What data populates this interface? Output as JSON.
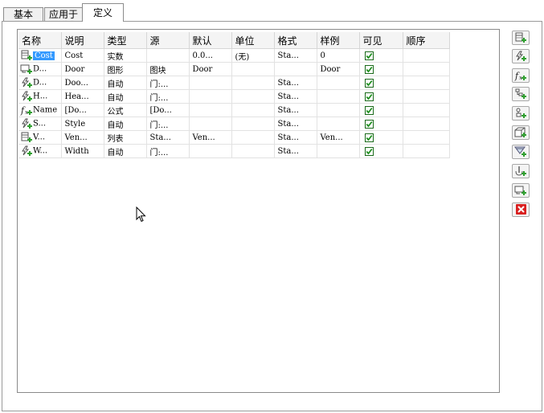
{
  "tabs": [
    {
      "label": "基本",
      "active": false
    },
    {
      "label": "应用于",
      "active": false
    },
    {
      "label": "定义",
      "active": true
    }
  ],
  "columns": [
    "名称",
    "说明",
    "类型",
    "源",
    "默认",
    "单位",
    "格式",
    "样例",
    "可见",
    "顺序"
  ],
  "rows": [
    {
      "icon": "table-plus-icon",
      "name": "Cost",
      "selected": true,
      "description": "Cost",
      "type": "实数",
      "source": "",
      "default": "0.0...",
      "unit": "(无)",
      "format": "Sta...",
      "example": "0",
      "visible": true,
      "order": ""
    },
    {
      "icon": "block-plus-icon",
      "name": "D...",
      "selected": false,
      "description": "Door",
      "type": "图形",
      "source": "图块",
      "default": "Door",
      "unit": "",
      "format": "",
      "example": "Door",
      "visible": true,
      "order": ""
    },
    {
      "icon": "auto-plus-icon",
      "name": "D...",
      "selected": false,
      "description": "Doo...",
      "type": "自动",
      "source": "门:...",
      "default": "",
      "unit": "",
      "format": "Sta...",
      "example": "",
      "visible": true,
      "order": ""
    },
    {
      "icon": "auto-plus-icon",
      "name": "H...",
      "selected": false,
      "description": "Hea...",
      "type": "自动",
      "source": "门:...",
      "default": "",
      "unit": "",
      "format": "Sta...",
      "example": "",
      "visible": true,
      "order": ""
    },
    {
      "icon": "formula-icon",
      "name": "Name",
      "selected": false,
      "description": "[Do...",
      "type": "公式",
      "source": "[Do...",
      "default": "",
      "unit": "",
      "format": "Sta...",
      "example": "",
      "visible": true,
      "order": ""
    },
    {
      "icon": "auto-plus-icon",
      "name": "S...",
      "selected": false,
      "description": "Style",
      "type": "自动",
      "source": "门:...",
      "default": "",
      "unit": "",
      "format": "Sta...",
      "example": "",
      "visible": true,
      "order": ""
    },
    {
      "icon": "table-plus-icon",
      "name": "V...",
      "selected": false,
      "description": "Ven...",
      "type": "列表",
      "source": "Sta...",
      "default": "Ven...",
      "unit": "",
      "format": "Sta...",
      "example": "Ven...",
      "visible": true,
      "order": ""
    },
    {
      "icon": "auto-plus-icon",
      "name": "W...",
      "selected": false,
      "description": "Width",
      "type": "自动",
      "source": "门:...",
      "default": "",
      "unit": "",
      "format": "Sta...",
      "example": "",
      "visible": true,
      "order": ""
    }
  ],
  "toolbar_buttons": [
    {
      "name": "add-manual-definition-button",
      "icon": "table-plus-icon"
    },
    {
      "name": "add-automatic-definition-button",
      "icon": "auto-plus-icon"
    },
    {
      "name": "add-formula-definition-button",
      "icon": "formula-icon"
    },
    {
      "name": "add-project-definition-button",
      "icon": "tree-plus-icon"
    },
    {
      "name": "add-anchor-definition-button",
      "icon": "anchor-plus-icon"
    },
    {
      "name": "add-classification-definition-button",
      "icon": "box-plus-icon"
    },
    {
      "name": "add-material-definition-button",
      "icon": "material-plus-icon"
    },
    {
      "name": "add-location-definition-button",
      "icon": "location-plus-icon"
    },
    {
      "name": "add-graphic-definition-button",
      "icon": "block-plus-icon"
    },
    {
      "name": "delete-definition-button",
      "icon": "delete-x-icon"
    }
  ],
  "colors": {
    "selection": "#3399ff",
    "check": "#1f8f1f",
    "delete": "#d92020",
    "plus": "#2e9e2e"
  }
}
